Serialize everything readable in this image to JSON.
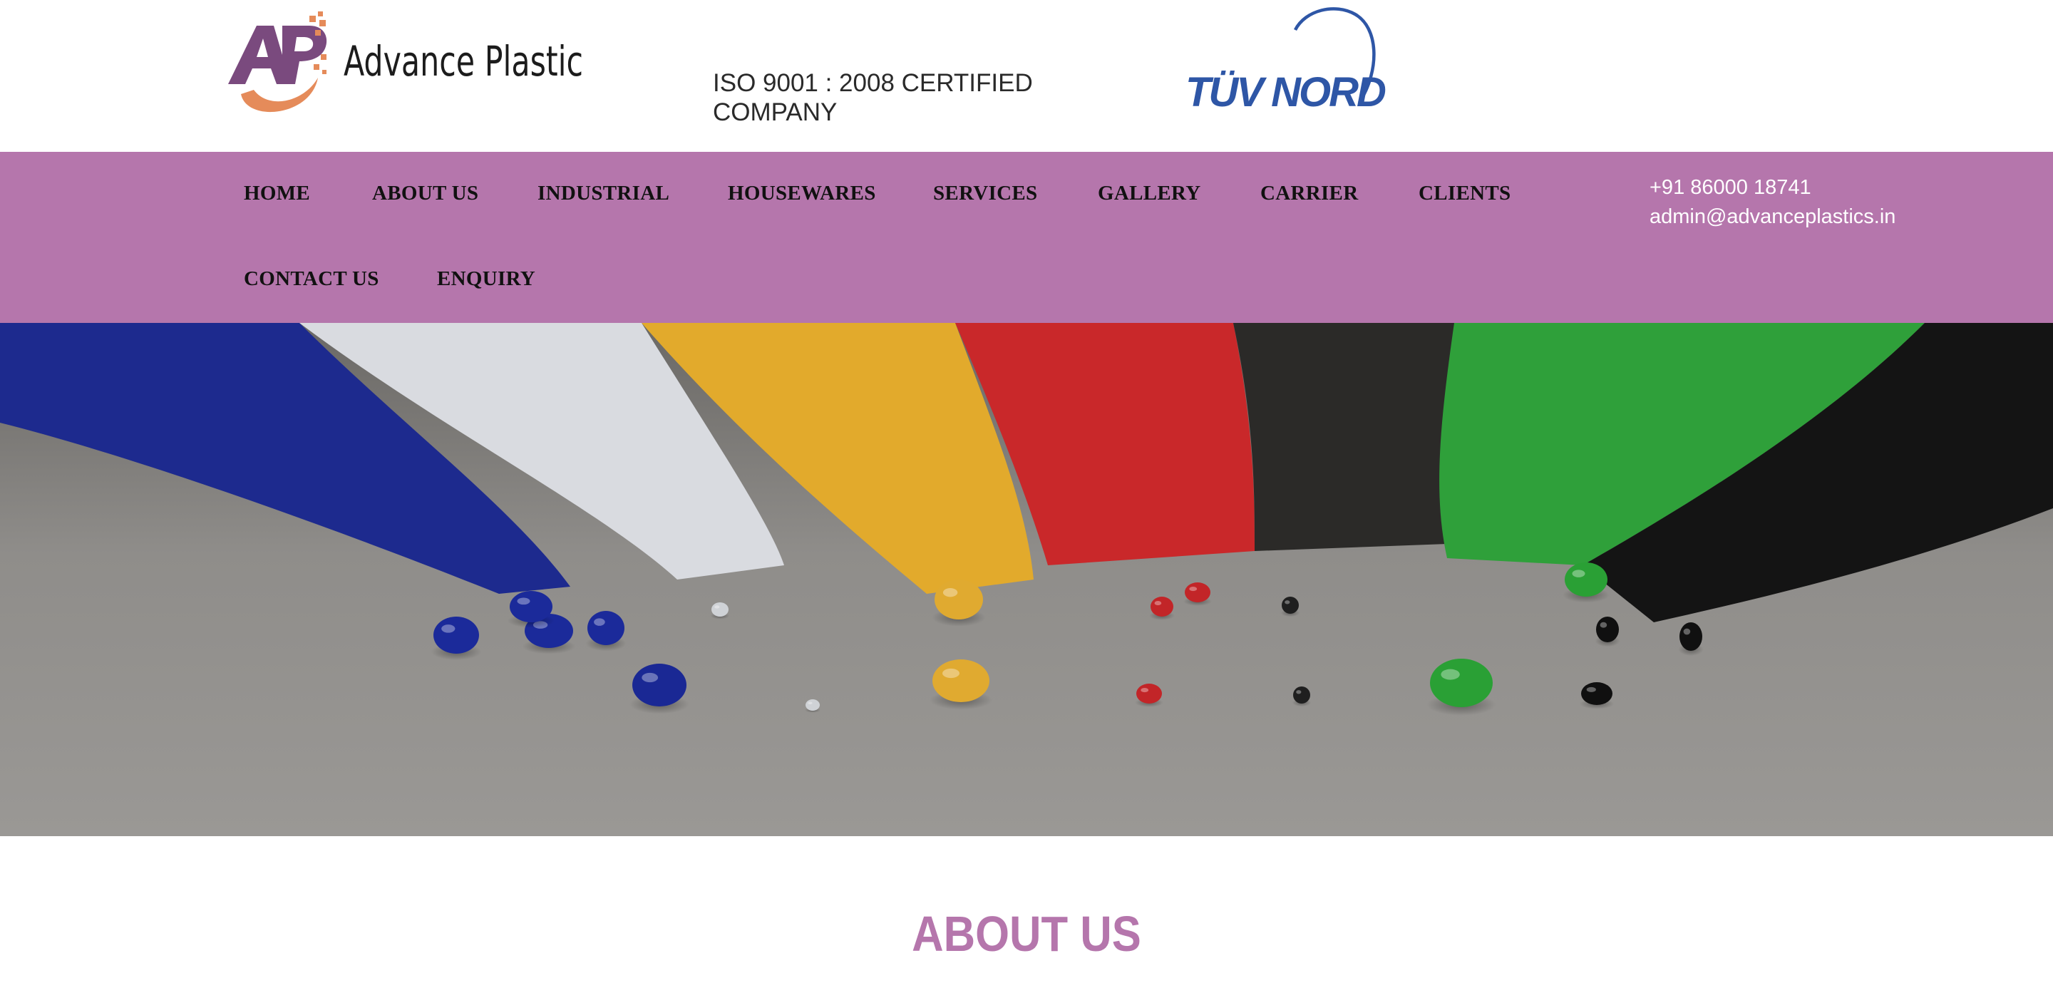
{
  "header": {
    "brand_name": "Advance Plastic",
    "logo_letters": "AP",
    "iso_text": "ISO 9001 : 2008 CERTIFIED COMPANY",
    "certifier_logo": "TÜV NORD"
  },
  "nav": {
    "items": [
      {
        "label": "HOME"
      },
      {
        "label": "ABOUT US"
      },
      {
        "label": "INDUSTRIAL"
      },
      {
        "label": "HOUSEWARES"
      },
      {
        "label": "SERVICES"
      },
      {
        "label": "GALLERY"
      },
      {
        "label": "CARRIER"
      },
      {
        "label": "CLIENTS"
      },
      {
        "label": "CONTACT US"
      },
      {
        "label": "ENQUIRY"
      }
    ],
    "phone": "+91 86000 18741",
    "email": "admin@advanceplastics.in"
  },
  "about": {
    "heading": "ABOUT US"
  },
  "colors": {
    "brand_purple": "#b576ac",
    "logo_purple": "#7a4a7e",
    "logo_orange": "#e58b5a",
    "tuv_blue": "#2e56a6"
  }
}
